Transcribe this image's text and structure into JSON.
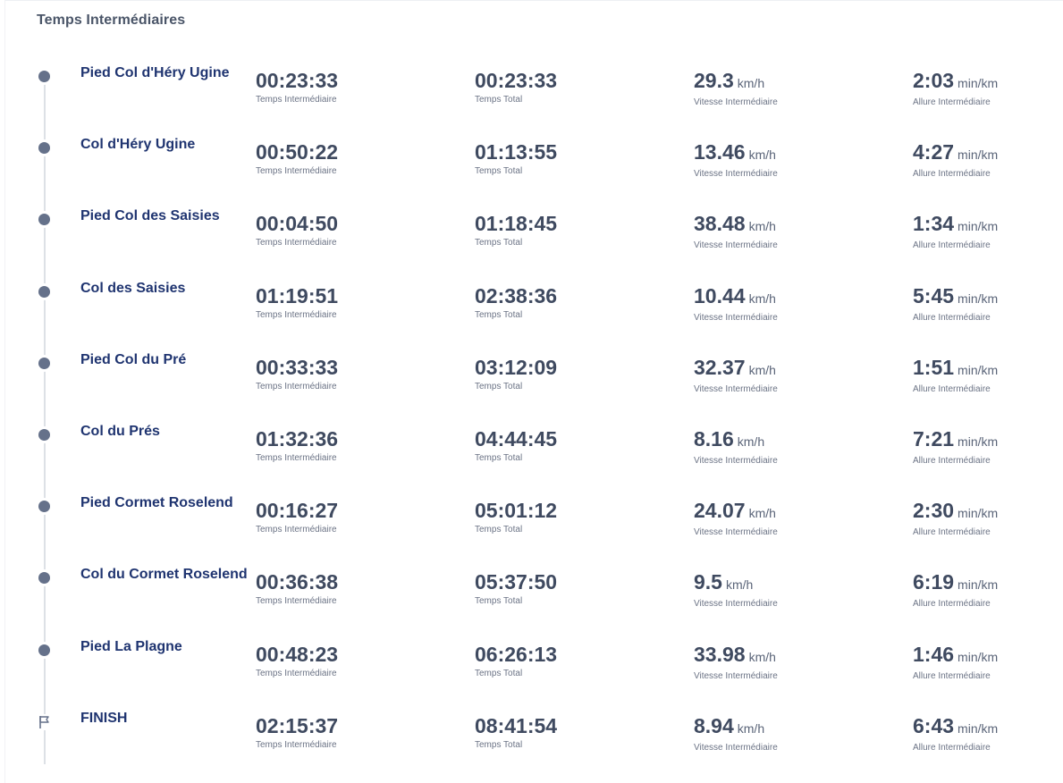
{
  "section_title": "Temps Intermédiaires",
  "labels": {
    "split_time": "Temps Intermédiaire",
    "total_time": "Temps Total",
    "split_speed": "Vitesse Intermédiaire",
    "split_pace": "Allure Intermédiaire"
  },
  "units": {
    "speed": "km/h",
    "pace": "min/km"
  },
  "icons": {
    "checkpoint": "checkpoint-dot-icon",
    "finish": "finish-flag-icon"
  },
  "colors": {
    "title": "#4a5568",
    "checkpoint_name": "#1f3470",
    "value": "#3f4a60",
    "dot": "#65718a",
    "line": "#dde1e6"
  },
  "splits": [
    {
      "name": "Pied Col d'Héry Ugine",
      "split_time": "00:23:33",
      "total_time": "00:23:33",
      "speed": "29.3",
      "pace": "2:03",
      "icon": "dot"
    },
    {
      "name": "Col d'Héry Ugine",
      "split_time": "00:50:22",
      "total_time": "01:13:55",
      "speed": "13.46",
      "pace": "4:27",
      "icon": "dot"
    },
    {
      "name": "Pied Col des Saisies",
      "split_time": "00:04:50",
      "total_time": "01:18:45",
      "speed": "38.48",
      "pace": "1:34",
      "icon": "dot"
    },
    {
      "name": "Col des Saisies",
      "split_time": "01:19:51",
      "total_time": "02:38:36",
      "speed": "10.44",
      "pace": "5:45",
      "icon": "dot"
    },
    {
      "name": "Pied Col du Pré",
      "split_time": "00:33:33",
      "total_time": "03:12:09",
      "speed": "32.37",
      "pace": "1:51",
      "icon": "dot"
    },
    {
      "name": "Col du Prés",
      "split_time": "01:32:36",
      "total_time": "04:44:45",
      "speed": "8.16",
      "pace": "7:21",
      "icon": "dot"
    },
    {
      "name": "Pied Cormet Roselend",
      "split_time": "00:16:27",
      "total_time": "05:01:12",
      "speed": "24.07",
      "pace": "2:30",
      "icon": "dot"
    },
    {
      "name": "Col du Cormet Roselend",
      "split_time": "00:36:38",
      "total_time": "05:37:50",
      "speed": "9.5",
      "pace": "6:19",
      "icon": "dot"
    },
    {
      "name": "Pied La Plagne",
      "split_time": "00:48:23",
      "total_time": "06:26:13",
      "speed": "33.98",
      "pace": "1:46",
      "icon": "dot"
    },
    {
      "name": "FINISH",
      "split_time": "02:15:37",
      "total_time": "08:41:54",
      "speed": "8.94",
      "pace": "6:43",
      "icon": "flag"
    }
  ]
}
